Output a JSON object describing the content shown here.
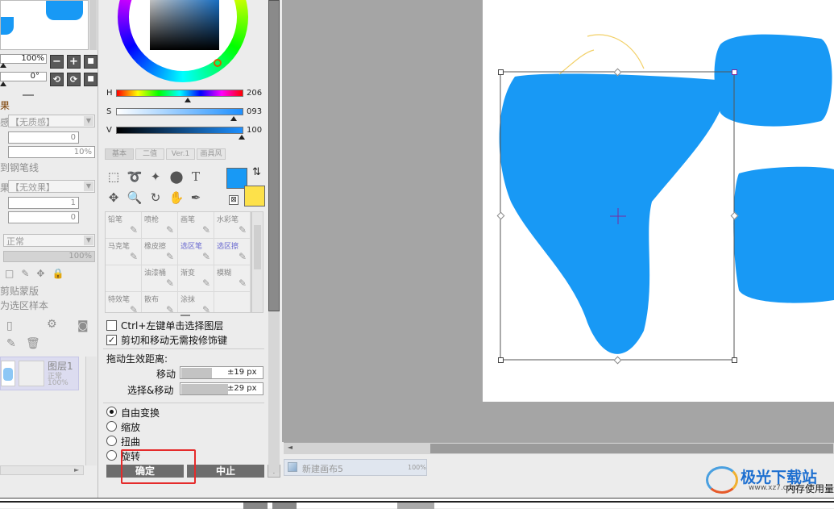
{
  "left": {
    "zoom": "100%",
    "angle": "0°",
    "effect_label": "果",
    "texture_label": "感",
    "texture_value": "【无质感】",
    "field1": "0",
    "field2": "10%",
    "to_pen_line": "到钢笔线",
    "effect2_label": "果",
    "effect2_value": "【无效果】",
    "field3": "1",
    "field4": "0",
    "blend_value": "正常",
    "opacity": "100%",
    "clip_label": "剪贴蒙版",
    "sample_label": "为选区样本",
    "layer_name": "图层1",
    "layer_mode": "正常",
    "layer_opacity": "100%"
  },
  "color": {
    "h_label": "H",
    "h_value": "206",
    "s_label": "S",
    "s_value": "093",
    "v_label": "V",
    "v_value": "100",
    "primary": "#1899f5",
    "secondary": "#fde14a"
  },
  "tabs": [
    "基本",
    "二值",
    "Ver.1",
    "画具风"
  ],
  "brushes": [
    [
      "铅笔",
      "喷枪",
      "画笔",
      "水彩笔"
    ],
    [
      "马克笔",
      "橡皮擦",
      "选区笔",
      "选区擦"
    ],
    [
      "",
      "油漆桶",
      "渐变",
      "模糊"
    ],
    [
      "特效笔",
      "散布",
      "涂抹",
      ""
    ]
  ],
  "options": {
    "ctrl_click": "Ctrl+左键单击选择图层",
    "no_modifier": "剪切和移动无需按修饰键",
    "drag_dist": "拖动生效距离:",
    "move_label": "移动",
    "move_value": "±19 px",
    "select_move_label": "选择&移动",
    "select_move_value": "±29 px"
  },
  "transform": {
    "free": "自由变换",
    "scale": "缩放",
    "distort": "扭曲",
    "rotate": "旋转",
    "ok": "确定",
    "cancel": "中止"
  },
  "statusbar": {
    "canvas_name": "新建画布5",
    "canvas_zoom": "100%",
    "memory": "内存使用量"
  },
  "watermark": {
    "text": "极光下载站",
    "url": "www.xz7.com"
  }
}
